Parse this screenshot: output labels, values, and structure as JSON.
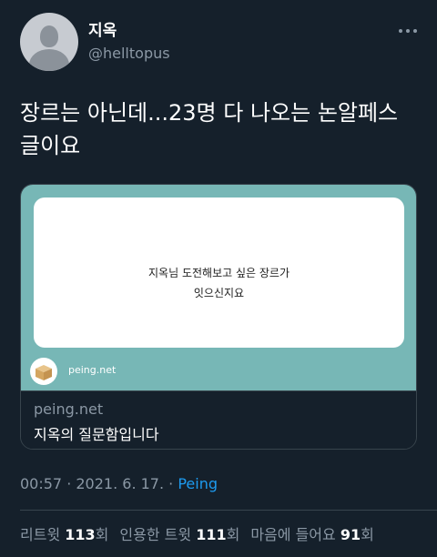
{
  "author": {
    "display_name": "지옥",
    "handle": "@helltopus"
  },
  "tweet": {
    "text": "장르는 아닌데...23명 다 나오는 논알페스\n글이요"
  },
  "card": {
    "question_text": "지옥님 도전해보고 싶은 장르가\n잇으신지요",
    "footer_domain": "peing.net",
    "domain": "peing.net",
    "title": "지옥의 질문함입니다"
  },
  "meta": {
    "time": "00:57",
    "separator1": " · ",
    "date": "2021. 6. 17.",
    "separator2": " · ",
    "source": "Peing"
  },
  "stats": {
    "retweets_label": "리트윗",
    "retweets_count": "113",
    "retweets_unit": "회",
    "quotes_label": "인용한 트윗",
    "quotes_count": "111",
    "quotes_unit": "회",
    "likes_label": "마음에 들어요",
    "likes_count": "91",
    "likes_unit": "회"
  },
  "icons": {
    "more": "more-horizontal-icon",
    "peing_logo": "peing-box-icon"
  },
  "colors": {
    "background": "#15202b",
    "card_image_bg": "#77b7b6",
    "link": "#1d9bf0",
    "secondary_text": "#8b98a5"
  }
}
